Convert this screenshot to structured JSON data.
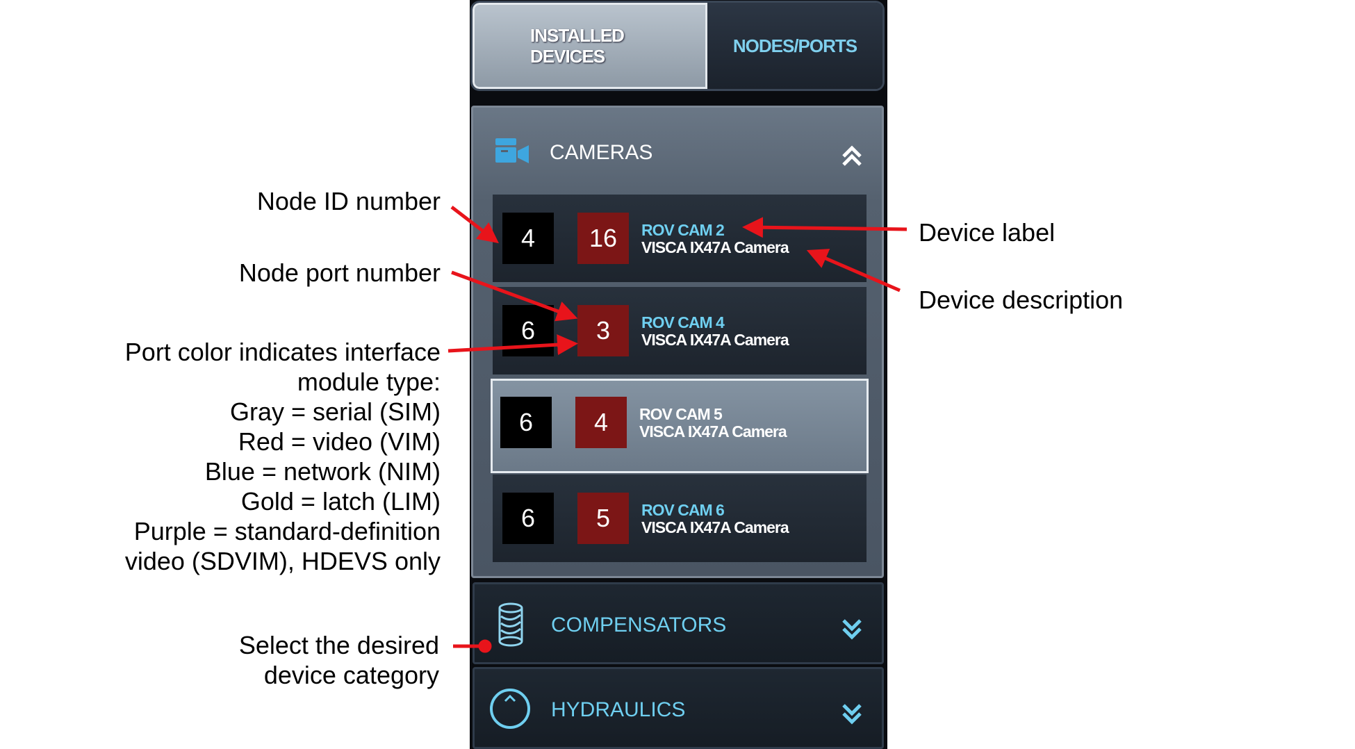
{
  "tabs": {
    "installed_line1": "INSTALLED",
    "installed_line2": "DEVICES",
    "nodes_ports": "NODES/PORTS"
  },
  "sections": {
    "cameras": {
      "title": "CAMERAS",
      "rows": [
        {
          "node": "4",
          "port": "16",
          "label": "ROV CAM 2",
          "desc": "VISCA IX47A Camera"
        },
        {
          "node": "6",
          "port": "3",
          "label": "ROV CAM 4",
          "desc": "VISCA IX47A Camera"
        },
        {
          "node": "6",
          "port": "4",
          "label": "ROV CAM 5",
          "desc": "VISCA IX47A Camera"
        },
        {
          "node": "6",
          "port": "5",
          "label": "ROV CAM 6",
          "desc": "VISCA IX47A Camera"
        }
      ]
    },
    "compensators": {
      "title": "COMPENSATORS"
    },
    "hydraulics": {
      "title": "HYDRAULICS"
    }
  },
  "annotations": {
    "node_id": "Node ID number",
    "node_port": "Node port number",
    "port_color": [
      "Port color indicates interface",
      "module type:",
      "Gray = serial (SIM)",
      "Red = video (VIM)",
      "Blue = network (NIM)",
      "Gold = latch (LIM)",
      "Purple = standard-definition",
      "video (SDVIM), HDEVS only"
    ],
    "select_category": [
      "Select the desired",
      "device category"
    ],
    "device_label": "Device label",
    "device_description": "Device description"
  },
  "colors": {
    "arrow": "#e8141b",
    "port_video_red": "#7c1616",
    "accent_cyan": "#6fcff0"
  }
}
